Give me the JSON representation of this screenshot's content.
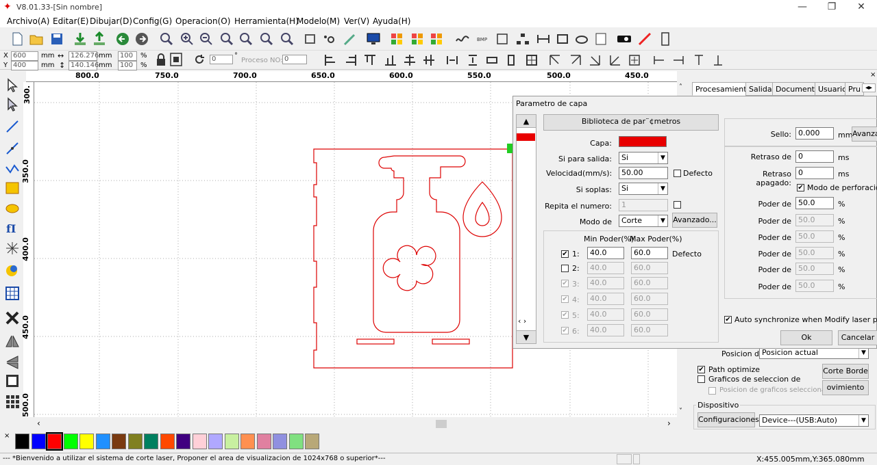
{
  "window": {
    "title": "V8.01.33-[Sin nombre]",
    "minimize": "—",
    "maximize": "❐",
    "close": "✕"
  },
  "menu": [
    "Archivo(A)",
    "Editar(E)",
    "Dibujar(D)",
    "Config(G)",
    "Operacion(O)",
    "Herramienta(H)",
    "Modelo(M)",
    "Ver(V)",
    "Ayuda(H)"
  ],
  "coords": {
    "x_label": "X",
    "x_value": "600",
    "y_label": "Y",
    "y_value": "400",
    "unit": "mm",
    "w_value": "126.276",
    "h_value": "140.146",
    "pct_w": "100",
    "pct_h": "100",
    "pct": "%",
    "rotation": "0",
    "degree": "°",
    "proceso_label": "Proceso NO:",
    "proceso_value": "0"
  },
  "ruler_h": [
    "800.0",
    "750.0",
    "700.0",
    "650.0",
    "600.0",
    "550.0",
    "500.0",
    "450.0"
  ],
  "ruler_v": [
    "300.",
    "350.0",
    "400.0",
    "450.0",
    "500.0"
  ],
  "right_tabs": [
    "Procesamiento",
    "Salida",
    "Documento",
    "Usuario",
    "Pru"
  ],
  "dialog": {
    "title": "Parametro de capa",
    "library_btn": "Biblioteca de par¨¢metros",
    "capa_label": "Capa:",
    "capa_color": "#e80000",
    "salida_label": "Si para salida:",
    "salida_value": "Si",
    "velocidad_label": "Velocidad(mm/s):",
    "velocidad_value": "50.00",
    "defecto": "Defecto",
    "soplas_label": "Si soplas:",
    "soplas_value": "Si",
    "repita_label": "Repita el numero:",
    "repita_value": "1",
    "modo_label": "Modo de",
    "modo_value": "Corte",
    "avanzado_btn": "Avanzado...",
    "min_header": "Min Poder(%)",
    "max_header": "Max Poder(%)",
    "power_rows": [
      {
        "n": "1:",
        "min": "40.0",
        "max": "60.0",
        "checked": "✔"
      },
      {
        "n": "2:",
        "min": "40.0",
        "max": "60.0",
        "checked": ""
      },
      {
        "n": "3:",
        "min": "40.0",
        "max": "60.0",
        "checked": "✔"
      },
      {
        "n": "4:",
        "min": "40.0",
        "max": "60.0",
        "checked": "✔"
      },
      {
        "n": "5:",
        "min": "40.0",
        "max": "60.0",
        "checked": "✔"
      },
      {
        "n": "6:",
        "min": "40.0",
        "max": "60.0",
        "checked": "✔"
      }
    ],
    "sello_label": "Sello:",
    "sello_value": "0.000",
    "mm": "mm",
    "ms": "ms",
    "avanza_btn": "Avanza",
    "retraso_label": "Retraso de",
    "retraso_value": "0",
    "retraso_apagado_label": "Retraso apagado:",
    "retraso_apagado_value": "0",
    "modo_perf_label": "Modo de perforacion la",
    "poder_label": "Poder de",
    "poder_values": [
      "50.0",
      "50.0",
      "50.0",
      "50.0",
      "50.0",
      "50.0"
    ],
    "auto_sync": "Auto synchronize when Modify laser para",
    "ok_btn": "Ok",
    "cancel_btn": "Cancelar"
  },
  "panel": {
    "posicion_label": "Posicion de",
    "posicion_value": "Posicion actual",
    "path_optimize": "Path optimize",
    "graficos_sel": "Graficos de seleccion de",
    "posicion_graficos": "Posicion de graficos seleccionado",
    "corte_borde": "Corte Borde",
    "movimiento_borde": "ovimiento Bord",
    "dispositivo": "Dispositivo",
    "configuraciones": "Configuraciones",
    "device_value": "Device---(USB:Auto)"
  },
  "palette": [
    "#000000",
    "#0000ff",
    "#ff0000",
    "#00ff00",
    "#ffff00",
    "#2090ff",
    "#7a3a10",
    "#808020",
    "#008060",
    "#ff4800",
    "#400080",
    "#ffd0d8",
    "#b0a8ff",
    "#c8f0a0",
    "#ff9050",
    "#e080a0",
    "#9090e0",
    "#80e080",
    "#b8a878"
  ],
  "status": {
    "message": "--- *Bienvenido a utilizar el sistema de corte laser, Proponer el area de visualizacion de 1024x768 o superior*---",
    "coords": "X:455.005mm,Y:365.080mm"
  }
}
